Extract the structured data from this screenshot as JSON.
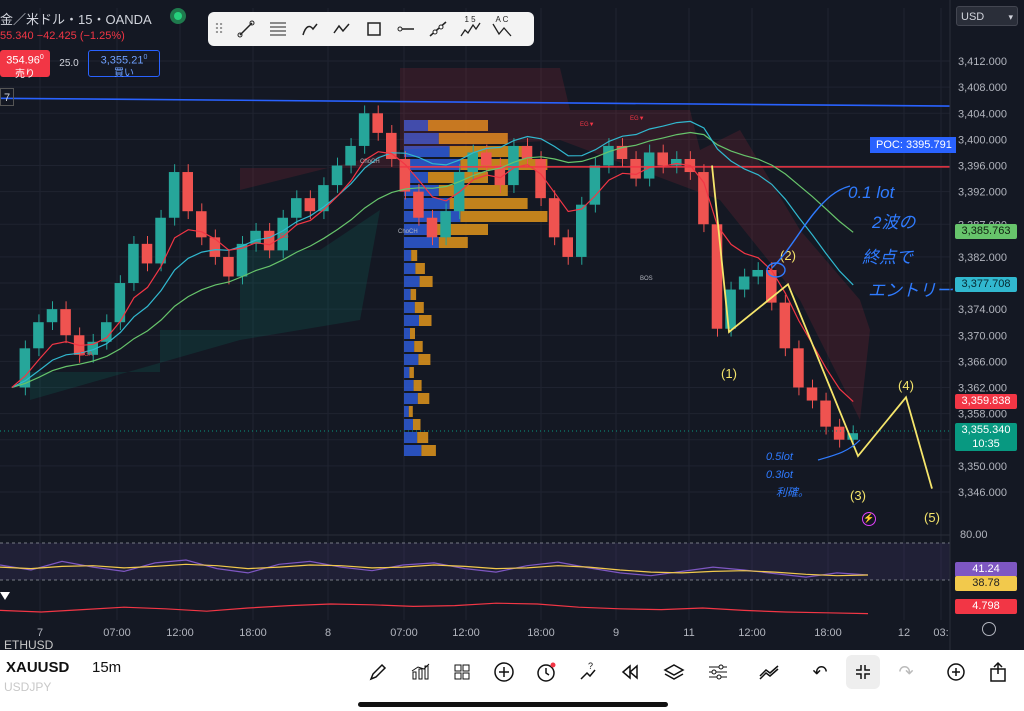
{
  "header": {
    "symbol_title": "金／米ドル・15・OANDA",
    "change_line": "55.340  −42.425 (−1.25%)",
    "sell_price": "354.96",
    "sell_price_sup": "0",
    "sell_label": "売り",
    "spread": "25.0",
    "buy_price": "3,355.21",
    "buy_price_sup": "0",
    "buy_label": "買い",
    "interval_box": "7",
    "currency": "USD"
  },
  "toolbar": {
    "icons": [
      "drag-handle-icon",
      "trend-line-icon",
      "fib-retracement-icon",
      "brush-icon",
      "path-icon",
      "rectangle-icon",
      "horizontal-ray-icon",
      "extended-line-icon",
      "elliott-impulse-icon",
      "elliott-correction-icon"
    ],
    "impulse_label": "1 5",
    "correction_label": "A C"
  },
  "price_axis": {
    "ticks": [
      "3,412.000",
      "3,408.000",
      "3,404.000",
      "3,400.000",
      "3,396.000",
      "3,392.000",
      "3,387.000",
      "3,382.000",
      "3,378.000",
      "3,374.000",
      "3,370.000",
      "3,366.000",
      "3,362.000",
      "3,358.000",
      "3,354.000",
      "3,350.000",
      "3,346.000"
    ],
    "tags": [
      {
        "label": "3,385.763",
        "color": "#67c46b",
        "text_color": "#102010"
      },
      {
        "label": "3,377.708",
        "color": "#31b8cf",
        "text_color": "#062830"
      },
      {
        "label": "3,359.838",
        "color": "#f23645",
        "text_color": "#ffffff"
      },
      {
        "label": "3,355.340",
        "sub": "10:35",
        "color": "#089981",
        "text_color": "#ffffff"
      }
    ],
    "poc_label": "POC: 3395.791"
  },
  "chart_data": {
    "type": "line",
    "title": "金／米ドル・15・OANDA",
    "symbol": "XAUUSD",
    "interval": "15m",
    "x_tick_labels": [
      "7",
      "07:00",
      "12:00",
      "18:00",
      "8",
      "07:00",
      "12:00",
      "18:00",
      "9",
      "11",
      "12:00",
      "18:00",
      "12",
      "03:"
    ],
    "ylim": [
      3344,
      3414
    ],
    "grid": true,
    "price_close": [
      3362,
      3368,
      3372,
      3374,
      3370,
      3367,
      3369,
      3372,
      3378,
      3384,
      3381,
      3388,
      3395,
      3389,
      3385,
      3382,
      3379,
      3384,
      3386,
      3383,
      3388,
      3391,
      3389,
      3393,
      3396,
      3399,
      3404,
      3401,
      3397,
      3392,
      3388,
      3385,
      3389,
      3395,
      3398,
      3396,
      3393,
      3399,
      3397,
      3391,
      3385,
      3382,
      3390,
      3396,
      3399,
      3397,
      3394,
      3398,
      3396,
      3397,
      3395,
      3387,
      3371,
      3377,
      3379,
      3380,
      3375,
      3368,
      3362,
      3360,
      3356,
      3354,
      3355
    ],
    "overlays": [
      {
        "name": "EMA 3385.763",
        "color": "#67c46b",
        "last": 3385.763
      },
      {
        "name": "EMA 3377.708",
        "color": "#31b8cf",
        "last": 3377.708
      },
      {
        "name": "EMA 3359.838",
        "color": "#f23645",
        "last": 3359.838
      }
    ],
    "resistance_line": {
      "from": 3406.3,
      "to": 3405.1,
      "color": "#2962ff"
    },
    "poc": 3395.791,
    "structure_labels": [
      "ChoCH",
      "BOS",
      "EG",
      "EG▼",
      "EG▼",
      "EGA",
      "ChoCH"
    ],
    "elliott_wave": {
      "labels": [
        "(1)",
        "(2)",
        "(3)",
        "(4)",
        "(5)"
      ],
      "prices": [
        3370.5,
        3377.8,
        3351.5,
        3360.5,
        3346.5
      ]
    },
    "annotations": {
      "note_top": [
        "0.1 lot",
        "2波の",
        "終点で",
        "エントリー"
      ],
      "note_bottom": [
        "0.5lot",
        "0.3lot",
        "利確。"
      ]
    },
    "oscillator": {
      "level_80": "80.00",
      "values_label": [
        "41.24",
        "38.78"
      ],
      "colors": [
        "#7e57c2",
        "#f2c94c"
      ],
      "series_a": [
        55,
        48,
        60,
        52,
        46,
        58,
        62,
        50,
        44,
        56,
        60,
        52,
        47,
        55,
        58,
        50,
        45,
        54,
        59,
        51,
        44,
        40,
        46,
        52,
        48,
        43,
        38,
        44,
        41
      ],
      "series_b": [
        52,
        50,
        53,
        54,
        51,
        53,
        56,
        54,
        50,
        52,
        55,
        54,
        51,
        52,
        55,
        53,
        50,
        51,
        54,
        52,
        48,
        45,
        44,
        46,
        47,
        45,
        42,
        40,
        41
      ]
    },
    "atr": {
      "value": "4.798",
      "color": "#f23645",
      "series": [
        5.2,
        5.0,
        5.3,
        5.6,
        5.4,
        5.1,
        5.5,
        5.8,
        6.0,
        5.9,
        5.7,
        5.8,
        6.1,
        6.0,
        5.6,
        5.4,
        5.3,
        5.5,
        5.2,
        5.0,
        4.9,
        4.8
      ]
    }
  },
  "bottom_bar": {
    "symbol": "XAUUSD",
    "interval": "15m",
    "watch_prev": "ETHUSD",
    "watch_next": "USDJPY",
    "icons": [
      "pencil-icon",
      "indicators-icon",
      "layout-grid-icon",
      "add-icon",
      "alert-icon",
      "replay-arrow-icon",
      "rewind-icon",
      "layers-icon",
      "settings-sliders-icon",
      "compare-icon",
      "undo-icon",
      "fullscreen-exit-icon",
      "redo-icon",
      "add-alert-icon",
      "share-icon"
    ]
  }
}
